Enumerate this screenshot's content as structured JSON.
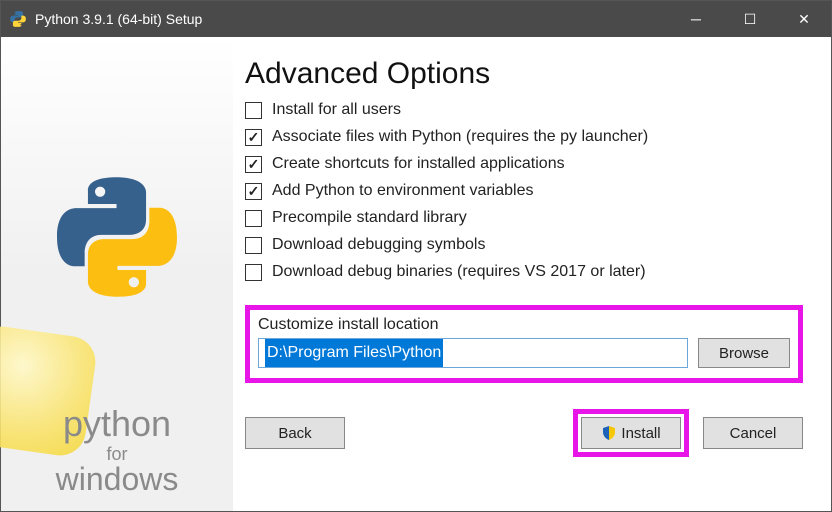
{
  "window": {
    "title": "Python 3.9.1 (64-bit) Setup"
  },
  "heading": "Advanced Options",
  "options": [
    {
      "label": "Install for all users",
      "checked": false
    },
    {
      "label": "Associate files with Python (requires the py launcher)",
      "checked": true
    },
    {
      "label": "Create shortcuts for installed applications",
      "checked": true
    },
    {
      "label": "Add Python to environment variables",
      "checked": true
    },
    {
      "label": "Precompile standard library",
      "checked": false
    },
    {
      "label": "Download debugging symbols",
      "checked": false
    },
    {
      "label": "Download debug binaries (requires VS 2017 or later)",
      "checked": false
    }
  ],
  "location": {
    "label": "Customize install location",
    "value": "D:\\Program Files\\Python",
    "browse": "Browse"
  },
  "buttons": {
    "back": "Back",
    "install": "Install",
    "cancel": "Cancel"
  },
  "brand": {
    "l1": "python",
    "l2": "for",
    "l3": "windows"
  },
  "highlight_color": "#e815e8"
}
